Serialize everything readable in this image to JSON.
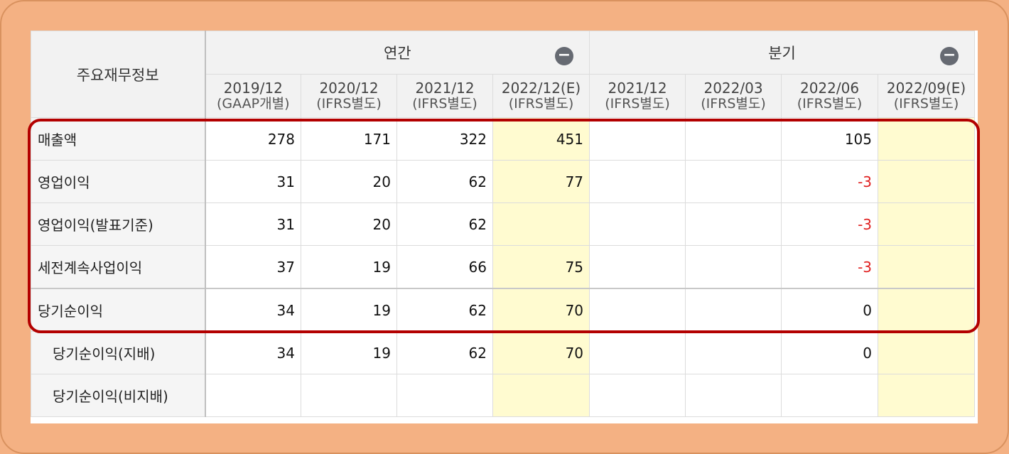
{
  "header": {
    "corner_label": "주요재무정보",
    "annual_label": "연간",
    "quarter_label": "분기",
    "collapse_symbol": "−",
    "columns": [
      {
        "period": "2019/12",
        "basis": "(GAAP개별)"
      },
      {
        "period": "2020/12",
        "basis": "(IFRS별도)"
      },
      {
        "period": "2021/12",
        "basis": "(IFRS별도)"
      },
      {
        "period": "2022/12(E)",
        "basis": "(IFRS별도)"
      },
      {
        "period": "2021/12",
        "basis": "(IFRS별도)"
      },
      {
        "period": "2022/03",
        "basis": "(IFRS별도)"
      },
      {
        "period": "2022/06",
        "basis": "(IFRS별도)"
      },
      {
        "period": "2022/09(E)",
        "basis": "(IFRS별도)"
      }
    ]
  },
  "rows": [
    {
      "label": "매출액",
      "values": [
        "278",
        "171",
        "322",
        "451",
        "",
        "",
        "105",
        ""
      ]
    },
    {
      "label": "영업이익",
      "values": [
        "31",
        "20",
        "62",
        "77",
        "",
        "",
        "-3",
        ""
      ]
    },
    {
      "label": "영업이익(발표기준)",
      "values": [
        "31",
        "20",
        "62",
        "",
        "",
        "",
        "-3",
        ""
      ]
    },
    {
      "label": "세전계속사업이익",
      "values": [
        "37",
        "19",
        "66",
        "75",
        "",
        "",
        "-3",
        ""
      ]
    },
    {
      "label": "당기순이익",
      "values": [
        "34",
        "19",
        "62",
        "70",
        "",
        "",
        "0",
        ""
      ]
    },
    {
      "label": "당기순이익(지배)",
      "values": [
        "34",
        "19",
        "62",
        "70",
        "",
        "",
        "0",
        ""
      ]
    },
    {
      "label": "당기순이익(비지배)",
      "values": [
        "",
        "",
        "",
        "",
        "",
        "",
        "",
        ""
      ]
    }
  ],
  "colors": {
    "background": "#f4b183",
    "estimate_fill": "#fffbd0",
    "negative_text": "#e02020",
    "highlight_border": "#b30000"
  }
}
